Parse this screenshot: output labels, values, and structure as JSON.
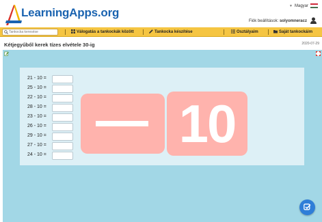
{
  "header": {
    "logo_text": "LearningApps.org",
    "language": "Magyar",
    "account_label": "Fiók beállítások:",
    "account_user": "solyomneracz"
  },
  "nav": {
    "search_placeholder": "Tankocka keresése",
    "items": [
      {
        "label": "Válogatás a tankockák között",
        "icon": "grid-icon"
      },
      {
        "label": "Tankocka készítése",
        "icon": "pencil-icon"
      },
      {
        "label": "Osztályaim",
        "icon": "list-icon"
      },
      {
        "label": "Saját tankockáim",
        "icon": "folder-icon"
      }
    ]
  },
  "app": {
    "title": "Kétjegyűből kerek tízes elvétele 30-ig",
    "date": "2020-07-29",
    "equations": [
      "21 - 10 =",
      "25 - 10 =",
      "22 - 10 =",
      "28 - 10 =",
      "23 - 10 =",
      "26 - 10 =",
      "29 - 10 =",
      "27 - 10 =",
      "24 - 10 ="
    ],
    "card_text": "10"
  },
  "colors": {
    "nav_bg": "#f5c542",
    "app_bg": "#a2d7e6",
    "panel_bg": "#ddf0f6",
    "card_bg": "#ffb3ad",
    "logo": "#1a63b0",
    "check_button": "#2f7ed8"
  }
}
